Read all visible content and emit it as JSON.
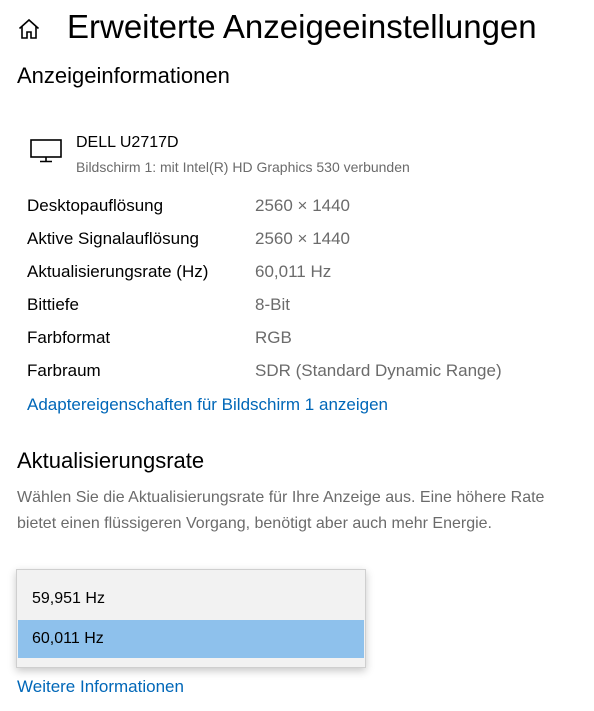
{
  "header": {
    "title": "Erweiterte Anzeigeeinstellungen",
    "home_icon": "home-icon"
  },
  "display_info": {
    "heading": "Anzeigeinformationen",
    "monitor": {
      "icon": "monitor-icon",
      "name": "DELL U2717D",
      "subtitle": "Bildschirm 1: mit Intel(R) HD Graphics 530 verbunden"
    },
    "rows": [
      {
        "label": "Desktopauflösung",
        "value": "2560 × 1440"
      },
      {
        "label": "Aktive Signalauflösung",
        "value": "2560 × 1440"
      },
      {
        "label": "Aktualisierungsrate (Hz)",
        "value": "60,011 Hz"
      },
      {
        "label": "Bittiefe",
        "value": "8-Bit"
      },
      {
        "label": "Farbformat",
        "value": "RGB"
      },
      {
        "label": "Farbraum",
        "value": "SDR (Standard Dynamic Range)"
      }
    ],
    "adapter_link": "Adaptereigenschaften für Bildschirm 1 anzeigen"
  },
  "refresh_rate": {
    "heading": "Aktualisierungsrate",
    "description": "Wählen Sie die Aktualisierungsrate für Ihre Anzeige aus. Eine höhere Rate bietet einen flüssigeren Vorgang, benötigt aber auch mehr Energie.",
    "options": [
      "59,951 Hz",
      "60,011 Hz"
    ],
    "selected": "60,011 Hz",
    "more_info_link": "Weitere Informationen"
  },
  "colors": {
    "accent_link": "#0067b8",
    "selected_option": "#8ec1ec",
    "secondary_text": "#6b6b6b"
  }
}
